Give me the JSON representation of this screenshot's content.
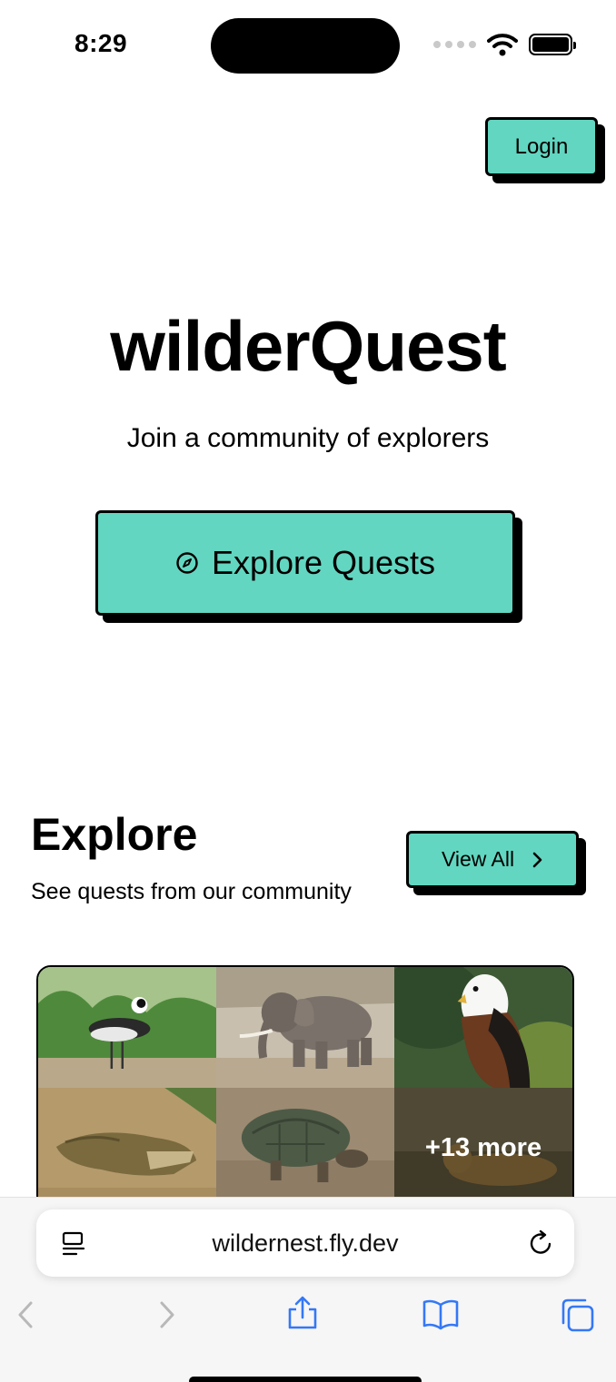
{
  "status_bar": {
    "time": "8:29",
    "icons": [
      "cellular-dots-icon",
      "wifi-icon",
      "battery-icon"
    ]
  },
  "header": {
    "login_label": "Login"
  },
  "hero": {
    "title": "wilderQuest",
    "subtitle": "Join a community of explorers",
    "cta_icon": "compass-icon",
    "cta_label": "Explore Quests"
  },
  "explore": {
    "title": "Explore",
    "subtitle": "See quests from our community",
    "view_all_label": "View All",
    "view_all_icon": "chevron-right-icon",
    "quest_photos": [
      {
        "subject": "plover-bird"
      },
      {
        "subject": "elephant"
      },
      {
        "subject": "fish-eagle"
      },
      {
        "subject": "crocodile"
      },
      {
        "subject": "tortoise"
      },
      {
        "subject": "leopard"
      }
    ],
    "more_label": "+13 more"
  },
  "browser": {
    "url": "wildernest.fly.dev",
    "icons": [
      "reader-icon",
      "reload-icon",
      "back-icon",
      "forward-icon",
      "share-icon",
      "bookmarks-icon",
      "tabs-icon"
    ]
  },
  "colors": {
    "accent": "#62d6c0",
    "border": "#000000",
    "ios_blue": "#3478f6"
  }
}
